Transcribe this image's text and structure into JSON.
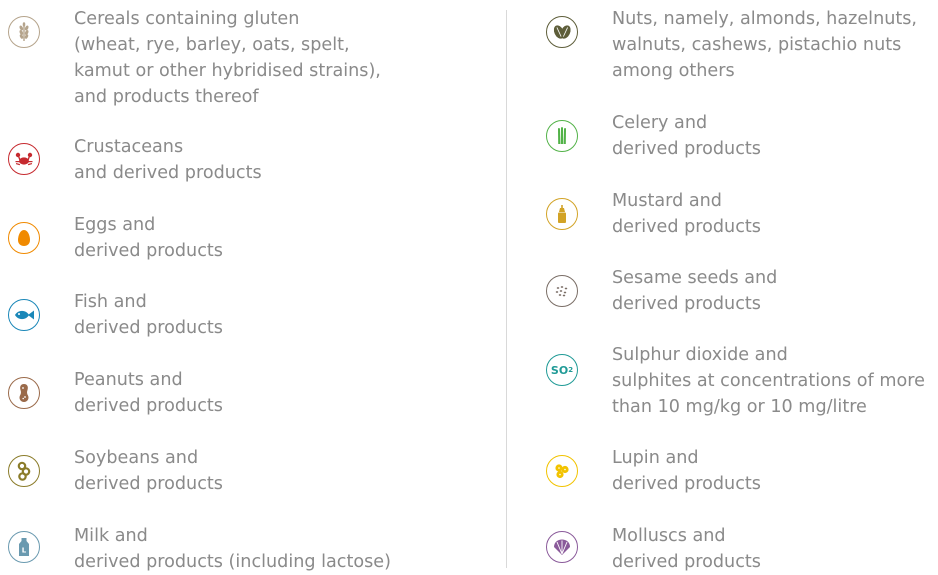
{
  "allergens": [
    {
      "id": "cereals",
      "icon": "wheat-icon",
      "color": "#b5a48c",
      "lines": [
        "Cereals containing gluten",
        "(wheat, rye, barley, oats, spelt,",
        "kamut or other hybridised strains),",
        "and products thereof"
      ]
    },
    {
      "id": "crustaceans",
      "icon": "crab-icon",
      "color": "#c62a2f",
      "lines": [
        "Crustaceans",
        "and derived products"
      ]
    },
    {
      "id": "eggs",
      "icon": "egg-icon",
      "color": "#f08a00",
      "lines": [
        "Eggs and",
        "derived products"
      ]
    },
    {
      "id": "fish",
      "icon": "fish-icon",
      "color": "#1a87b8",
      "lines": [
        "Fish and",
        "derived products"
      ]
    },
    {
      "id": "peanuts",
      "icon": "peanut-icon",
      "color": "#9a6a4a",
      "lines": [
        "Peanuts and",
        "derived products"
      ]
    },
    {
      "id": "soybeans",
      "icon": "soybean-icon",
      "color": "#8b7c2a",
      "lines": [
        "Soybeans and",
        "derived products"
      ]
    },
    {
      "id": "milk",
      "icon": "milk-bottle-icon",
      "color": "#6a9ab0",
      "lines": [
        "Milk and",
        "derived products (including lactose)"
      ]
    },
    {
      "id": "nuts",
      "icon": "nuts-icon",
      "color": "#5e5e3a",
      "lines": [
        "Nuts, namely, almonds, hazelnuts,",
        "walnuts, cashews, pistachio nuts",
        "among others"
      ]
    },
    {
      "id": "celery",
      "icon": "celery-icon",
      "color": "#52b248",
      "lines": [
        "Celery and",
        "derived products"
      ]
    },
    {
      "id": "mustard",
      "icon": "mustard-bottle-icon",
      "color": "#d2a326",
      "lines": [
        "Mustard and",
        "derived products"
      ]
    },
    {
      "id": "sesame",
      "icon": "sesame-seeds-icon",
      "color": "#7a6e66",
      "lines": [
        "Sesame seeds and",
        "derived products"
      ]
    },
    {
      "id": "sulphites",
      "icon": "so2-icon",
      "color": "#1f9a96",
      "icon_text": "SO",
      "icon_sup": "2",
      "lines": [
        "Sulphur dioxide and",
        "sulphites at concentrations of more",
        "than 10 mg/kg or 10 mg/litre"
      ]
    },
    {
      "id": "lupin",
      "icon": "lupin-icon",
      "color": "#f2c300",
      "lines": [
        "Lupin and",
        "derived products"
      ]
    },
    {
      "id": "molluscs",
      "icon": "shell-icon",
      "color": "#8a5a9a",
      "lines": [
        "Molluscs and",
        "derived products"
      ]
    }
  ]
}
